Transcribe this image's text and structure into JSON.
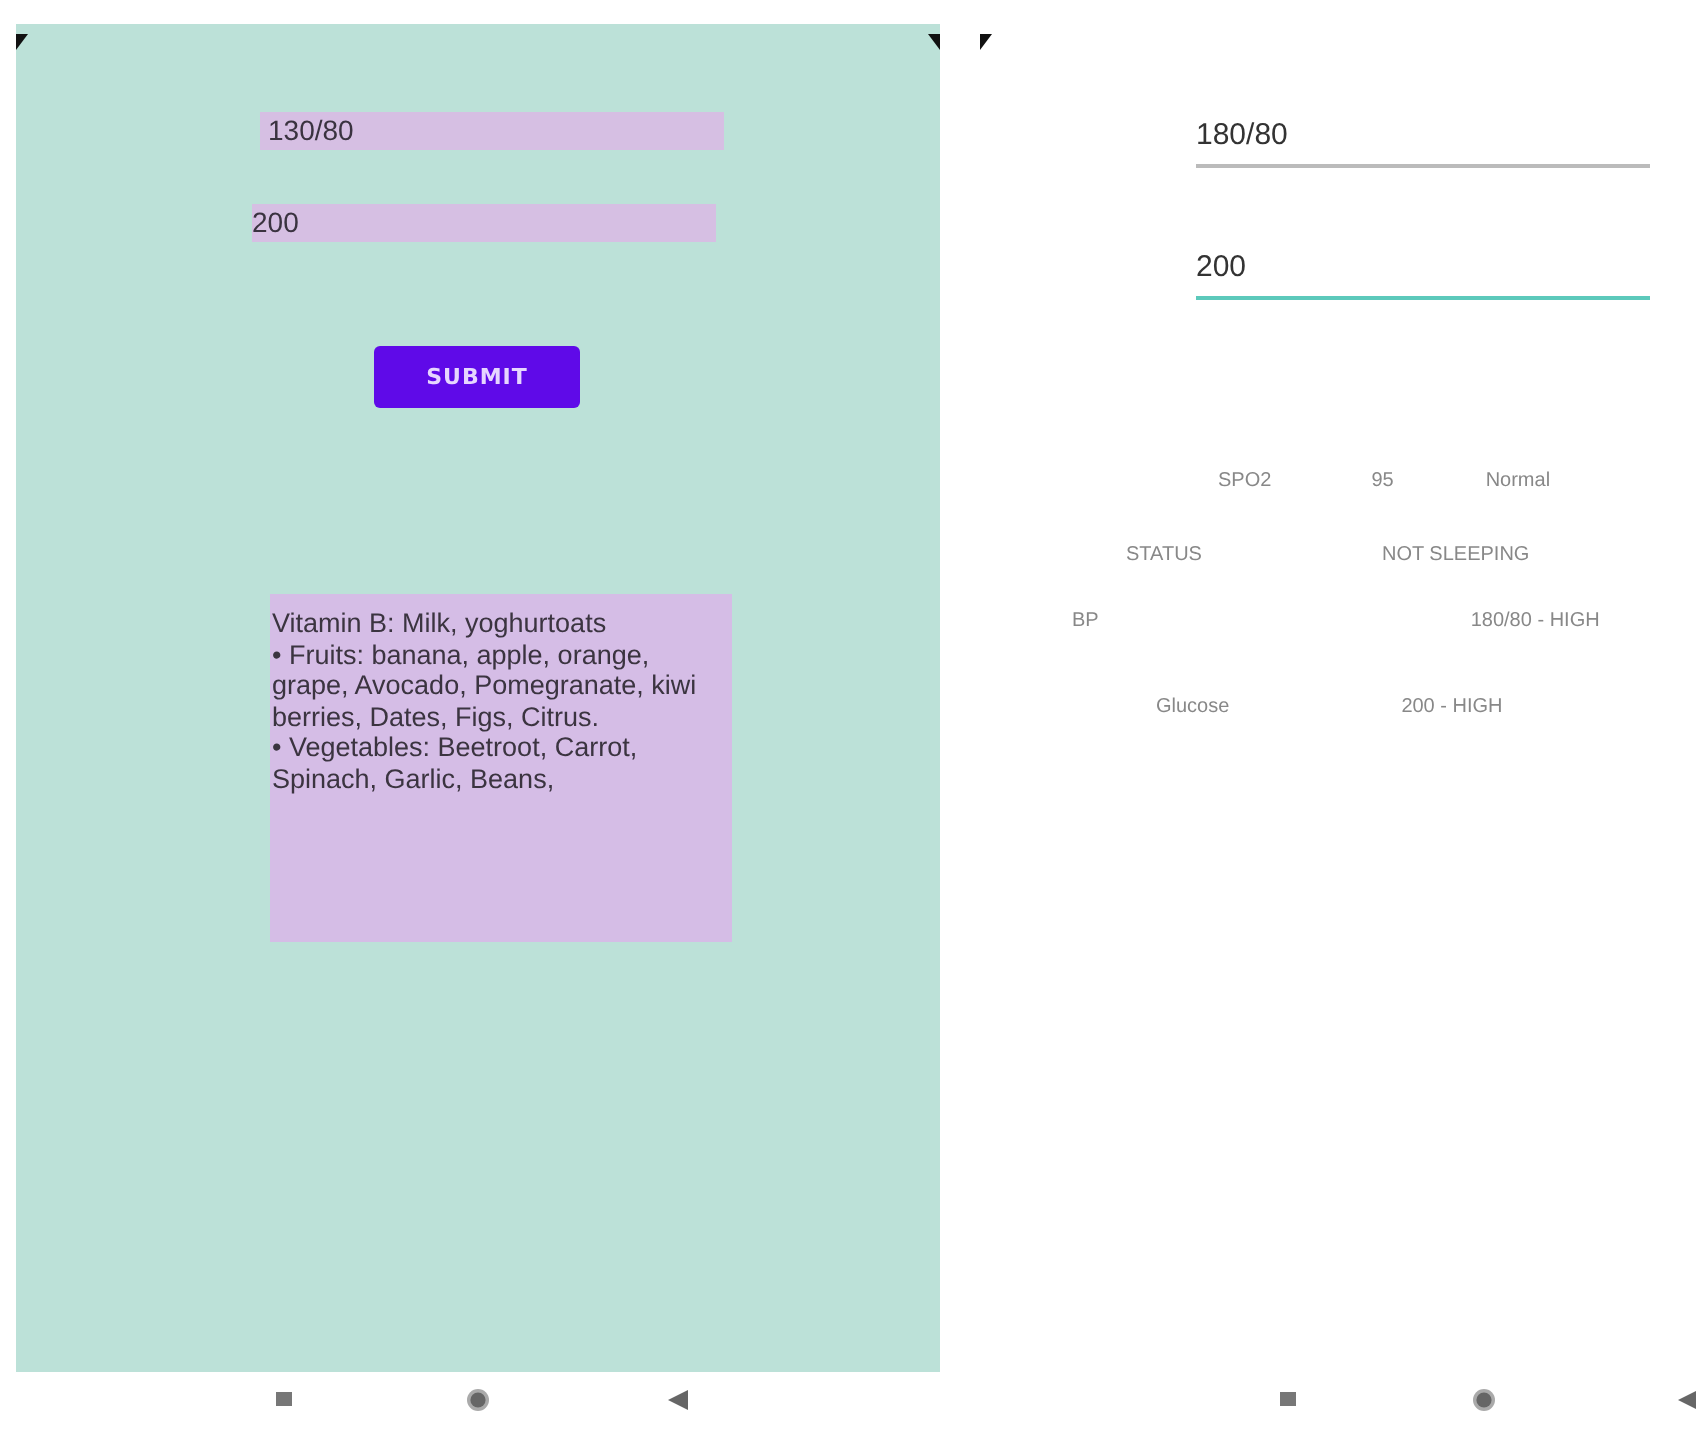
{
  "left_screen": {
    "fields": [
      {
        "value": "130/80"
      },
      {
        "value": "200"
      }
    ],
    "submit_button": "SUBMIT",
    "diet_text": [
      "Vitamin B: Milk, yoghurtoats",
      "• Fruits: banana, apple, orange, grape, Avocado, Pomegranate, kiwi berries, Dates, Figs, Citrus.",
      "• Vegetables: Beetroot, Carrot, Spinach, Garlic, Beans,"
    ]
  },
  "right_screen": {
    "fields": [
      {
        "value": "180/80",
        "focused": false
      },
      {
        "value": "200",
        "focused": true
      }
    ],
    "readings": [
      {
        "cells": [
          "SPO2",
          "95",
          "Normal"
        ]
      },
      {
        "cells": [
          "STATUS",
          "NOT SLEEPING"
        ]
      },
      {
        "cells": [
          "BP",
          "180/80 - HIGH"
        ]
      },
      {
        "cells": [
          "Glucose",
          "200 - HIGH"
        ]
      }
    ]
  }
}
